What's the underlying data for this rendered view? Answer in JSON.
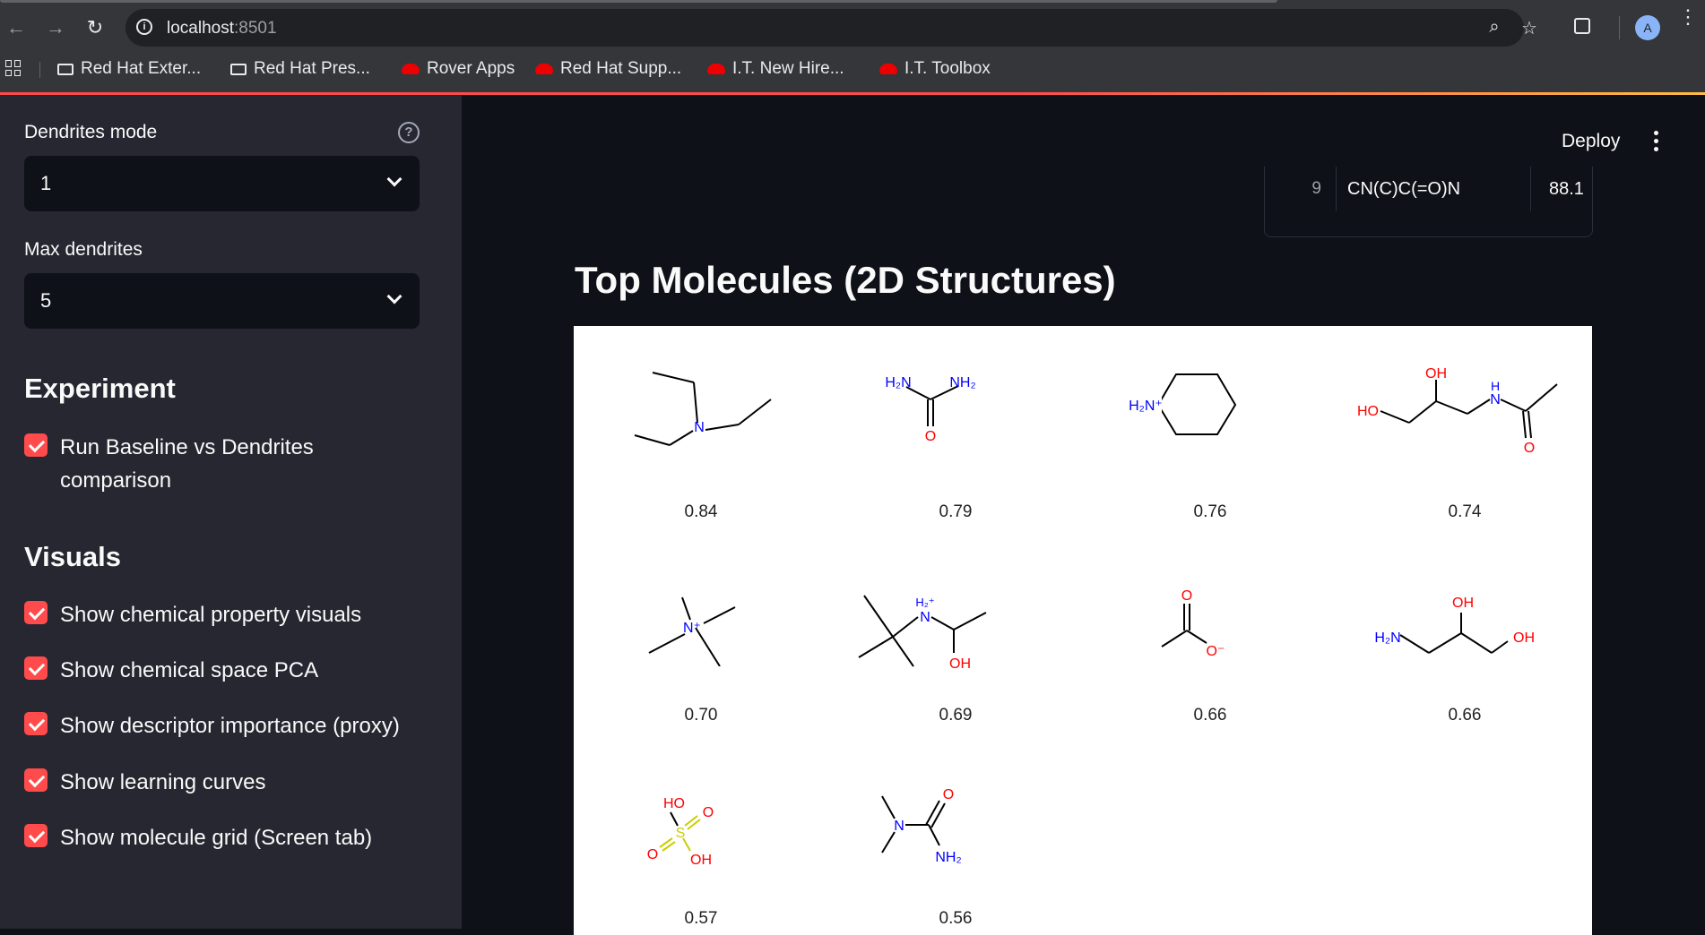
{
  "browser": {
    "url_host": "localhost",
    "url_port": ":8501",
    "bookmarks": [
      {
        "label": "Red Hat Exter...",
        "icon": "folder-icon"
      },
      {
        "label": "Red Hat Pres...",
        "icon": "folder-icon"
      },
      {
        "label": "Rover Apps",
        "icon": "redhat-icon"
      },
      {
        "label": "Red Hat Supp...",
        "icon": "redhat-icon"
      },
      {
        "label": "I.T. New Hire...",
        "icon": "redhat-icon"
      },
      {
        "label": "I.T. Toolbox",
        "icon": "redhat-icon"
      }
    ],
    "avatar_letter": "A"
  },
  "sidebar": {
    "dendrites_mode": {
      "label": "Dendrites mode",
      "value": "1"
    },
    "max_dendrites": {
      "label": "Max dendrites",
      "value": "5"
    },
    "experiment": {
      "heading": "Experiment",
      "options": [
        {
          "label": "Run Baseline vs Dendrites comparison",
          "checked": true
        }
      ]
    },
    "visuals": {
      "heading": "Visuals",
      "options": [
        {
          "label": "Show chemical property visuals",
          "checked": true
        },
        {
          "label": "Show chemical space PCA",
          "checked": true
        },
        {
          "label": "Show descriptor importance (proxy)",
          "checked": true
        },
        {
          "label": "Show learning curves",
          "checked": true
        },
        {
          "label": "Show molecule grid (Screen tab)",
          "checked": true
        }
      ]
    }
  },
  "header": {
    "deploy_label": "Deploy"
  },
  "table": {
    "row": {
      "index": "9",
      "smiles": "CN(C)C(=O)N",
      "score": "88.1"
    }
  },
  "main": {
    "title": "Top Molecules (2D Structures)",
    "molecules": [
      {
        "score": "0.84",
        "name": "triethylamine"
      },
      {
        "score": "0.79",
        "name": "urea"
      },
      {
        "score": "0.76",
        "name": "piperidinium"
      },
      {
        "score": "0.74",
        "name": "dihydroxypropyl-acetamide"
      },
      {
        "score": "0.70",
        "name": "tetramethylammonium"
      },
      {
        "score": "0.69",
        "name": "tert-butylamino-propanol"
      },
      {
        "score": "0.66",
        "name": "acetate"
      },
      {
        "score": "0.66",
        "name": "aminopropanediol"
      },
      {
        "score": "0.57",
        "name": "sulfuric-acid"
      },
      {
        "score": "0.56",
        "name": "dimethylurea"
      }
    ],
    "atom_colors": {
      "nitrogen": "#0000ff",
      "oxygen": "#ff0000",
      "sulfur": "#cccc00",
      "carbon": "#000000"
    }
  },
  "theme": {
    "accent": "#ff4b4b",
    "sidebar_bg": "#262730",
    "main_bg": "#0e1117"
  }
}
